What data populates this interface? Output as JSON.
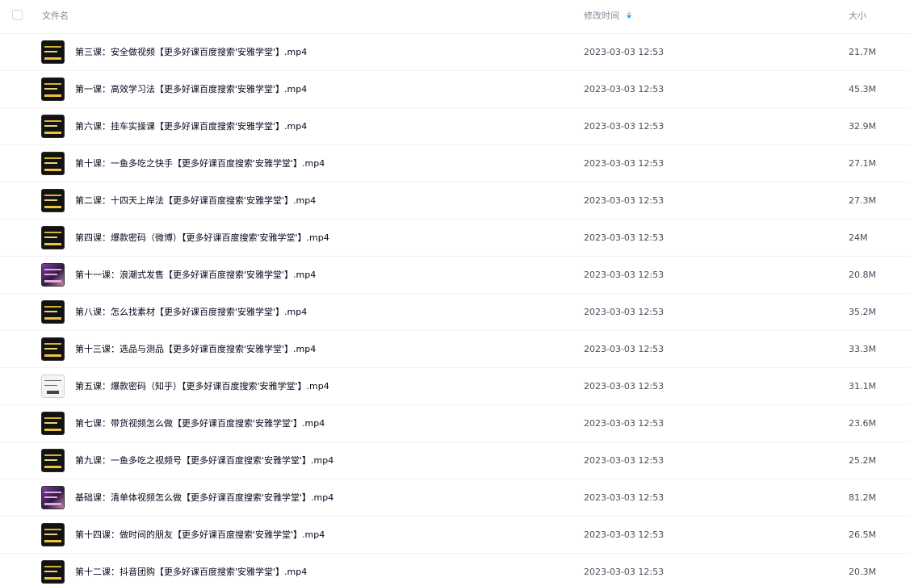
{
  "header": {
    "name_label": "文件名",
    "time_label": "修改时间",
    "size_label": "大小"
  },
  "files": [
    {
      "name": "第三课：安全做视频【更多好课百度搜索'安雅学堂'】.mp4",
      "time": "2023-03-03 12:53",
      "size": "21.7M",
      "thumb": "dark"
    },
    {
      "name": "第一课：高效学习法【更多好课百度搜索'安雅学堂'】.mp4",
      "time": "2023-03-03 12:53",
      "size": "45.3M",
      "thumb": "dark"
    },
    {
      "name": "第六课：挂车实操课【更多好课百度搜索'安雅学堂'】.mp4",
      "time": "2023-03-03 12:53",
      "size": "32.9M",
      "thumb": "dark"
    },
    {
      "name": "第十课：一鱼多吃之快手【更多好课百度搜索'安雅学堂'】.mp4",
      "time": "2023-03-03 12:53",
      "size": "27.1M",
      "thumb": "dark"
    },
    {
      "name": "第二课：十四天上岸法【更多好课百度搜索'安雅学堂'】.mp4",
      "time": "2023-03-03 12:53",
      "size": "27.3M",
      "thumb": "dark"
    },
    {
      "name": "第四课：爆款密码（微博）【更多好课百度搜索'安雅学堂'】.mp4",
      "time": "2023-03-03 12:53",
      "size": "24M",
      "thumb": "dark"
    },
    {
      "name": "第十一课：浪潮式发售【更多好课百度搜索'安雅学堂'】.mp4",
      "time": "2023-03-03 12:53",
      "size": "20.8M",
      "thumb": "color"
    },
    {
      "name": "第八课：怎么找素材【更多好课百度搜索'安雅学堂'】.mp4",
      "time": "2023-03-03 12:53",
      "size": "35.2M",
      "thumb": "dark"
    },
    {
      "name": "第十三课：选品与测品【更多好课百度搜索'安雅学堂'】.mp4",
      "time": "2023-03-03 12:53",
      "size": "33.3M",
      "thumb": "dark"
    },
    {
      "name": "第五课：爆款密码（知乎）【更多好课百度搜索'安雅学堂'】.mp4",
      "time": "2023-03-03 12:53",
      "size": "31.1M",
      "thumb": "pale"
    },
    {
      "name": "第七课：带货视频怎么做【更多好课百度搜索'安雅学堂'】.mp4",
      "time": "2023-03-03 12:53",
      "size": "23.6M",
      "thumb": "dark"
    },
    {
      "name": "第九课：一鱼多吃之视频号【更多好课百度搜索'安雅学堂'】.mp4",
      "time": "2023-03-03 12:53",
      "size": "25.2M",
      "thumb": "dark"
    },
    {
      "name": "基础课：清单体视频怎么做【更多好课百度搜索'安雅学堂'】.mp4",
      "time": "2023-03-03 12:53",
      "size": "81.2M",
      "thumb": "color"
    },
    {
      "name": "第十四课：做时间的朋友【更多好课百度搜索'安雅学堂'】.mp4",
      "time": "2023-03-03 12:53",
      "size": "26.5M",
      "thumb": "dark"
    },
    {
      "name": "第十二课：抖音团购【更多好课百度搜索'安雅学堂'】.mp4",
      "time": "2023-03-03 12:53",
      "size": "20.3M",
      "thumb": "dark"
    }
  ],
  "colors": {
    "sort_active": "#06a7ff",
    "text_primary": "#03081a",
    "text_secondary": "#818999"
  },
  "icons": {
    "sort": "sort-arrows-icon",
    "file_thumbnail": "video-thumbnail-icon"
  }
}
